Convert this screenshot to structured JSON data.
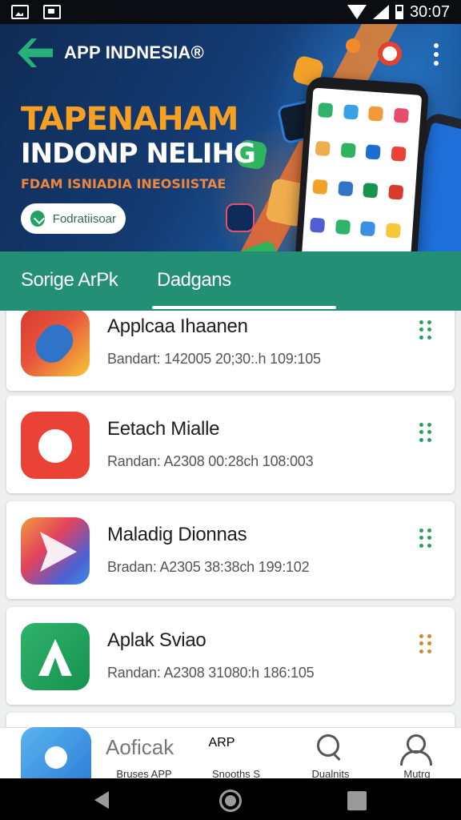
{
  "status_bar": {
    "time": "30:07"
  },
  "header": {
    "brand_name": "APP INDNESIA®",
    "hero_title": "TAPENAHAM",
    "hero_subtitle": "INDONP NELIHG",
    "hero_tagline": "FDAM ISNIADIA INEOSIISTAE",
    "hero_button_label": "Fodratiisoar"
  },
  "tabs": [
    {
      "label": "Sorige ArPk"
    },
    {
      "label": "Dadgans"
    }
  ],
  "apps": [
    {
      "name": "Applcaa Ihaanen",
      "meta": "Bandart: 142005   20;30:.h  109:105"
    },
    {
      "name": "Eetach Mialle",
      "meta": "Randan:  A2308   00:28ch  108:003"
    },
    {
      "name": "Maladig Dionnas",
      "meta": "Bradan:  A2305   38:38ch  199:102"
    },
    {
      "name": "Aplak Sviao",
      "meta": "Randan:  A2308   31080:h  186:105"
    },
    {
      "name": "Aoficak",
      "meta": ""
    }
  ],
  "bottom_nav": [
    {
      "label": "Bruses APP",
      "icon": "app-grid-icon"
    },
    {
      "label": "Snooths S",
      "icon": "arp-badge-icon",
      "icon_text": "ARP"
    },
    {
      "label": "Dualnits",
      "icon": "search-icon"
    },
    {
      "label": "Mutrg",
      "icon": "user-icon"
    }
  ],
  "colors": {
    "accent_green": "#238f75",
    "hero_orange": "#f5a023",
    "kebab_green": "#2d9f5c",
    "kebab_orange": "#d2882b"
  }
}
